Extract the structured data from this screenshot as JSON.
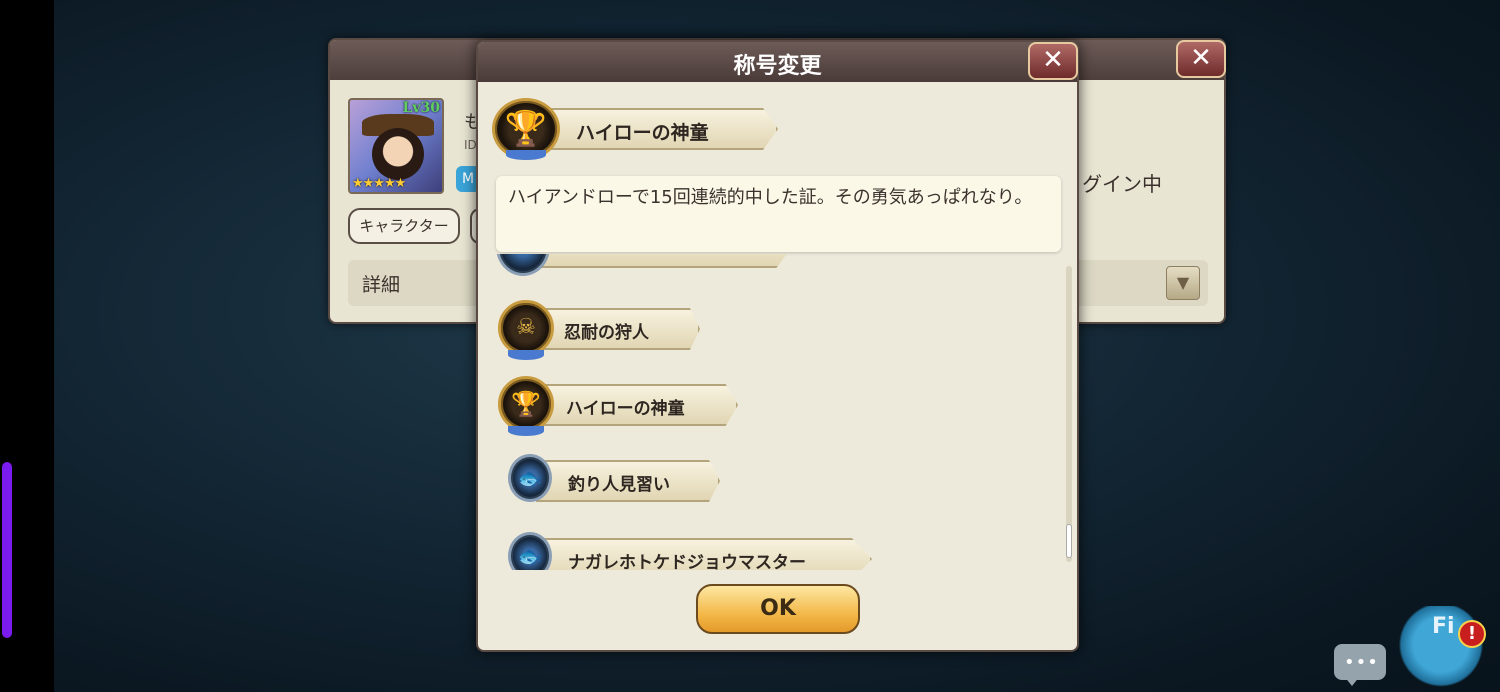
{
  "dialog": {
    "title": "称号変更",
    "close_glyph": "✕",
    "selected": {
      "title": "ハイローの神童",
      "icon": "trophy-badge-icon"
    },
    "tooltip": "ハイアンドローで15回連続的中した証。その勇気あっぱれなり。",
    "titles": [
      {
        "label": "忍耐の狩人",
        "icon": "hunter-badge-icon"
      },
      {
        "label": "ハイローの神童",
        "icon": "trophy-badge-icon"
      },
      {
        "label": "釣り人見習い",
        "icon": "fish-badge-icon"
      },
      {
        "label": "ナガレホトケドジョウマスター",
        "icon": "fish-badge-icon"
      }
    ],
    "ok_label": "OK"
  },
  "profile": {
    "level": "Lv30",
    "stars": "★★★★★",
    "name_fragment": "も",
    "id_fragment": "ID",
    "tag_fragment": "M",
    "character_button": "キャラクター",
    "login_status_fragment": "グイン中",
    "detail_label": "詳細",
    "close_glyph": "✕",
    "dropdown_glyph": "▼"
  },
  "overlay": {
    "chat_glyph": "•••",
    "mascot_label": "Fi",
    "alert_glyph": "!"
  },
  "colors": {
    "header": "#5a4a44",
    "panel": "#eeeadb",
    "ok_button": "#f3b94a",
    "side_handle": "#7a1cf0"
  }
}
